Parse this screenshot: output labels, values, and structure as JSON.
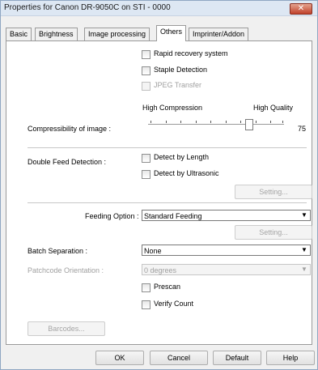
{
  "window": {
    "title": "Properties for Canon DR-9050C on STI - 0000",
    "close_glyph": "✕"
  },
  "tabs": [
    {
      "label": "Basic"
    },
    {
      "label": "Brightness"
    },
    {
      "label": "Image processing"
    },
    {
      "label": "Others"
    },
    {
      "label": "Imprinter/Addon"
    }
  ],
  "options": {
    "rapid_recovery": "Rapid recovery system",
    "staple_detection": "Staple Detection",
    "jpeg_transfer": "JPEG Transfer"
  },
  "compression": {
    "low_label": "High Compression",
    "high_label": "High Quality",
    "label": "Compressibility of image :",
    "value": "75"
  },
  "double_feed": {
    "label": "Double Feed Detection :",
    "by_length": "Detect by Length",
    "by_ultrasonic": "Detect by Ultrasonic",
    "setting_button": "Setting..."
  },
  "feeding": {
    "label": "Feeding Option :",
    "value": "Standard Feeding",
    "setting_button": "Setting..."
  },
  "batch": {
    "label": "Batch Separation :",
    "value": "None"
  },
  "patchcode": {
    "label": "Patchcode Orientation :",
    "value": "0 degrees"
  },
  "misc": {
    "prescan": "Prescan",
    "verify_count": "Verify Count",
    "barcodes_button": "Barcodes..."
  },
  "footer": {
    "ok": "OK",
    "cancel": "Cancel",
    "default": "Default",
    "help": "Help"
  }
}
